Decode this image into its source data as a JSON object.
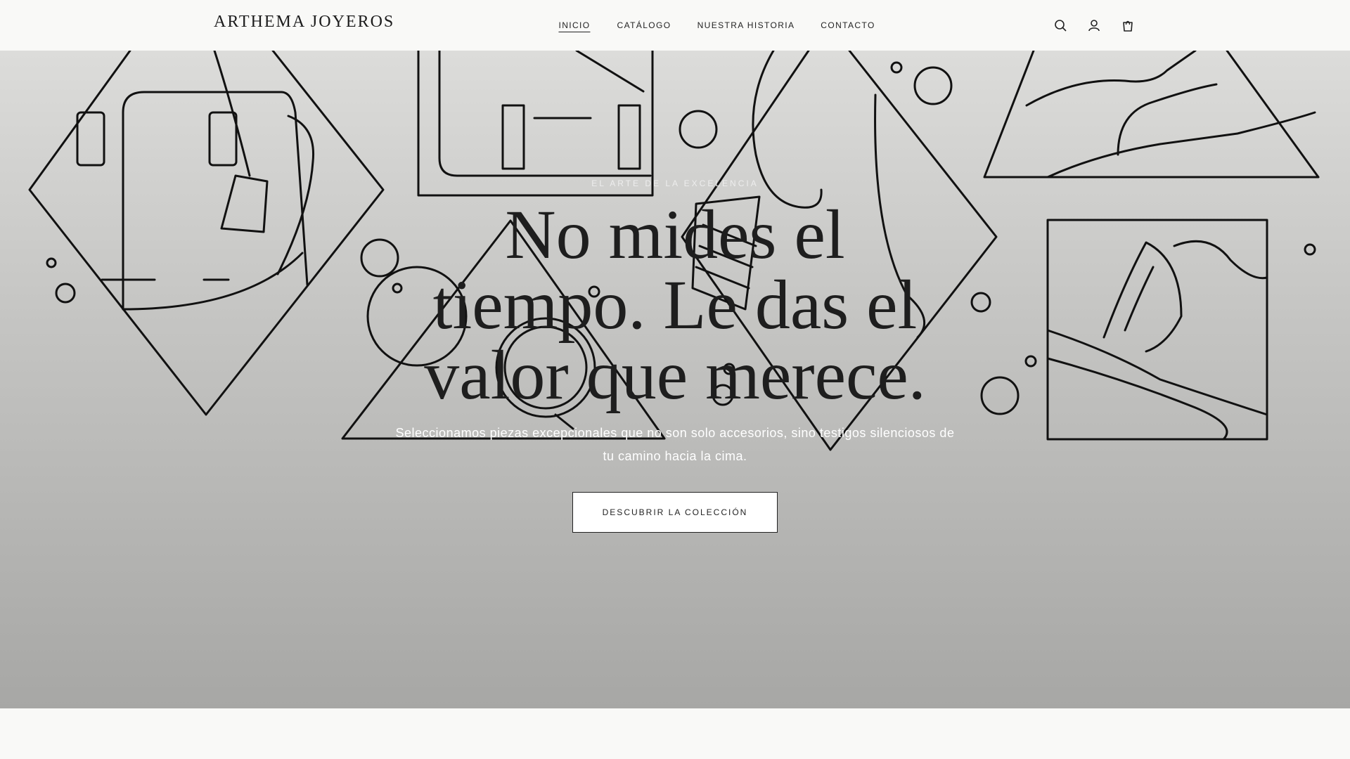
{
  "brand": {
    "name": "ARTHEMA JOYEROS"
  },
  "nav": {
    "items": [
      "INICIO",
      "CATÁLOGO",
      "NUESTRA HISTORIA",
      "CONTACTO"
    ],
    "active": "INICIO"
  },
  "header_icons": [
    "search-icon",
    "user-icon",
    "shopping-bag-icon"
  ],
  "hero": {
    "eyebrow": "EL ARTE DE LA EXCELENCIA",
    "title": "No mides el tiempo. Le das el valor que merece.",
    "subtitle": "Seleccionamos piezas excepcionales que no son solo accesorios, sino testigos silenciosos de tu camino hacia la cima.",
    "cta": "DESCUBRIR LA COLECCIÓN"
  },
  "colors": {
    "background": "#f9f9f7",
    "text": "#1e1e1e",
    "hero_top": "#dcdcda",
    "hero_bottom": "#a7a7a5",
    "button": "#ffffff"
  }
}
